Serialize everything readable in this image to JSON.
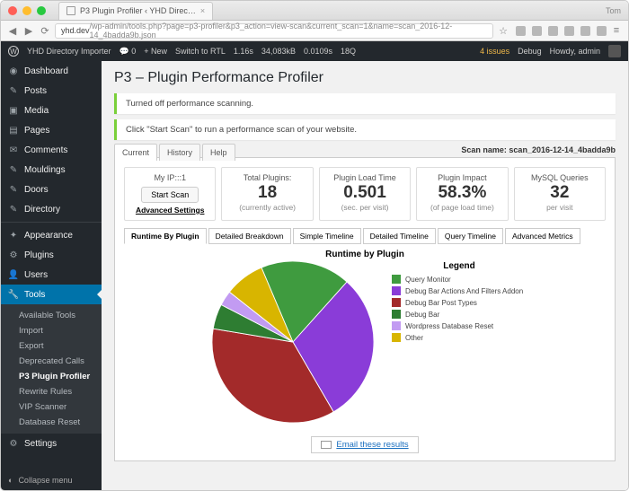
{
  "window": {
    "tab_title": "P3 Plugin Profiler ‹ YHD Direc…",
    "user": "Tom"
  },
  "addressbar": {
    "host": "yhd.dev",
    "path": "/wp-admin/tools.php?page=p3-profiler&p3_action=view-scan&current_scan=1&name=scan_2016-12-14_4badda9b.json"
  },
  "adminbar": {
    "site": "YHD Directory Importer",
    "comments": "0",
    "new": "New",
    "rtl": "Switch to RTL",
    "t1": "1.16s",
    "t2": "34,083kB",
    "t3": "0.0109s",
    "t4": "18Q",
    "issues": "4 issues",
    "debug": "Debug",
    "howdy": "Howdy, admin"
  },
  "sidebar": {
    "items": [
      {
        "label": "Dashboard",
        "icon": "◉"
      },
      {
        "label": "Posts",
        "icon": "✎"
      },
      {
        "label": "Media",
        "icon": "▣"
      },
      {
        "label": "Pages",
        "icon": "▤"
      },
      {
        "label": "Comments",
        "icon": "✉"
      },
      {
        "label": "Mouldings",
        "icon": "✎"
      },
      {
        "label": "Doors",
        "icon": "✎"
      },
      {
        "label": "Directory",
        "icon": "✎"
      },
      {
        "label": "Appearance",
        "icon": "✦"
      },
      {
        "label": "Plugins",
        "icon": "⚙"
      },
      {
        "label": "Users",
        "icon": "👤"
      },
      {
        "label": "Tools",
        "icon": "🔧"
      },
      {
        "label": "Settings",
        "icon": "⚙"
      }
    ],
    "tools_sub": [
      "Available Tools",
      "Import",
      "Export",
      "Deprecated Calls",
      "P3 Plugin Profiler",
      "Rewrite Rules",
      "VIP Scanner",
      "Database Reset"
    ],
    "collapse": "Collapse menu"
  },
  "page": {
    "title": "P3 – Plugin Performance Profiler",
    "notice1": "Turned off performance scanning.",
    "notice2": "Click \"Start Scan\" to run a performance scan of your website.",
    "scan_name_label": "Scan name:",
    "scan_name": "scan_2016-12-14_4badda9b",
    "tabs": [
      "Current",
      "History",
      "Help"
    ],
    "metrics": {
      "ip_label": "My IP:::1",
      "start_scan": "Start Scan",
      "adv": "Advanced Settings",
      "plugins_h": "Total Plugins:",
      "plugins_v": "18",
      "plugins_s": "(currently active)",
      "load_h": "Plugin Load Time",
      "load_v": "0.501",
      "load_s": "(sec. per visit)",
      "impact_h": "Plugin Impact",
      "impact_v": "58.3%",
      "impact_s": "(of page load time)",
      "mysql_h": "MySQL Queries",
      "mysql_v": "32",
      "mysql_s": "per visit"
    },
    "subtabs": [
      "Runtime By Plugin",
      "Detailed Breakdown",
      "Simple Timeline",
      "Detailed Timeline",
      "Query Timeline",
      "Advanced Metrics"
    ],
    "chart_title": "Runtime by Plugin",
    "legend_title": "Legend",
    "email": "Email these results"
  },
  "chart_data": {
    "type": "pie",
    "title": "Runtime by Plugin",
    "series": [
      {
        "name": "Query Monitor",
        "value": 18,
        "color": "#3f9b3f"
      },
      {
        "name": "Debug Bar Actions And Filters Addon",
        "value": 30,
        "color": "#8a3cd8"
      },
      {
        "name": "Debug Bar Post Types",
        "value": 36,
        "color": "#a32a2a"
      },
      {
        "name": "Debug Bar",
        "value": 5,
        "color": "#2e7d32"
      },
      {
        "name": "Wordpress Database Reset",
        "value": 3,
        "color": "#c29bf2"
      },
      {
        "name": "Other",
        "value": 8,
        "color": "#d8b500"
      }
    ]
  }
}
